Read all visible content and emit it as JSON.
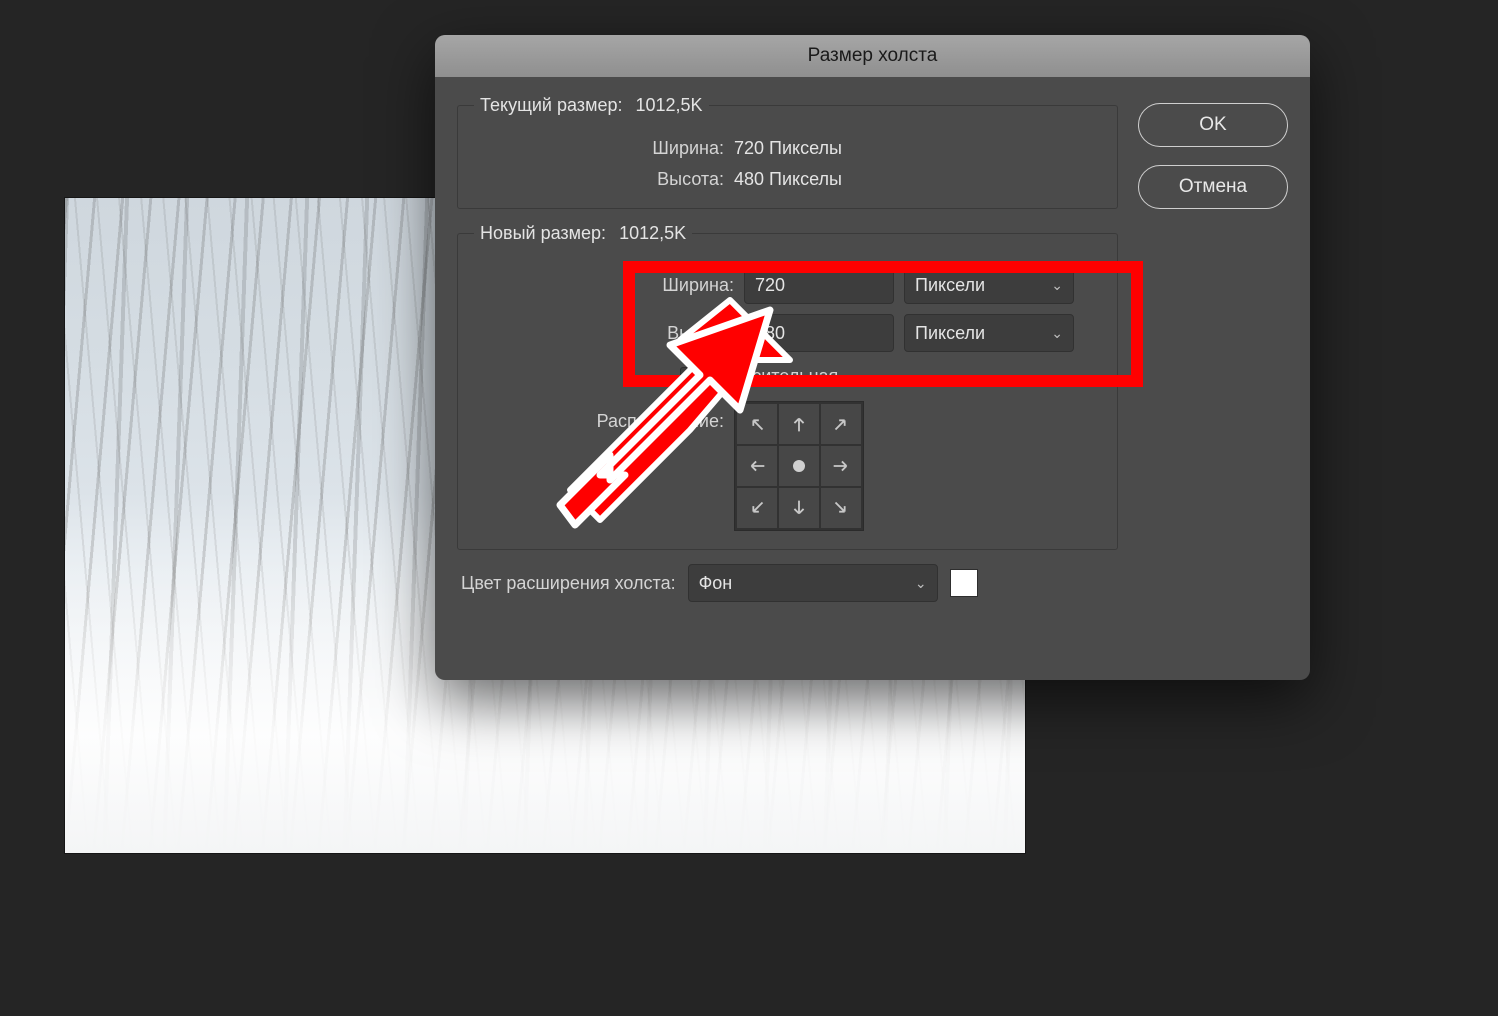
{
  "dialog": {
    "title": "Размер холста",
    "ok_label": "OK",
    "cancel_label": "Отмена"
  },
  "current": {
    "legend": "Текущий размер:",
    "size_value": "1012,5K",
    "width_label": "Ширина:",
    "width_value": "720 Пикселы",
    "height_label": "Высота:",
    "height_value": "480 Пикселы"
  },
  "newSize": {
    "legend": "Новый размер:",
    "size_value": "1012,5K",
    "width_label": "Ширина:",
    "width_value": "720",
    "width_unit": "Пиксели",
    "height_label": "Высота:",
    "height_value": "480",
    "height_unit": "Пиксели",
    "relative_label": "Относительная",
    "anchor_label": "Расположение:"
  },
  "ext": {
    "label": "Цвет расширения холста:",
    "value": "Фон",
    "swatch_color": "#ffffff"
  }
}
